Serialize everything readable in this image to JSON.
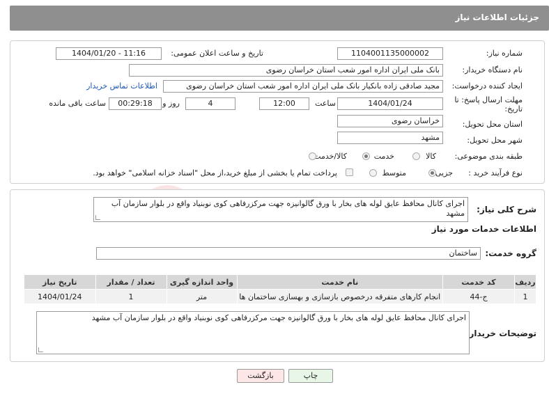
{
  "header": {
    "title": "جزئیات اطلاعات نیاز"
  },
  "form": {
    "need_number": {
      "label": "شماره نیاز:",
      "value": "1104001135000002"
    },
    "announce_datetime": {
      "label": "تاریخ و ساعت اعلان عمومی:",
      "value": "1404/01/20 - 11:16"
    },
    "buyer_org": {
      "label": "نام دستگاه خریدار:",
      "value": "بانک ملی ایران اداره امور شعب استان خراسان رضوی"
    },
    "requester": {
      "label": "ایجاد کننده درخواست:",
      "value": "مجید صادقی زاده بانکیار بانک ملی ایران اداره امور شعب استان خراسان رضوی",
      "contact_link": "اطلاعات تماس خریدار"
    },
    "deadline": {
      "label": "مهلت ارسال پاسخ: تا تاریخ:",
      "date": "1404/01/24",
      "time_label": "ساعت",
      "time": "12:00",
      "days": "4",
      "days_label": "روز و",
      "remaining": "00:29:18",
      "remaining_label": "ساعت باقی مانده"
    },
    "delivery_province": {
      "label": "استان محل تحویل:",
      "value": "خراسان رضوی"
    },
    "delivery_city": {
      "label": "شهر محل تحویل:",
      "value": "مشهد"
    },
    "category": {
      "label": "طبقه بندی موضوعی:",
      "options": [
        "کالا",
        "خدمت",
        "کالا/خدمت"
      ],
      "selected": "خدمت"
    },
    "process": {
      "label": "نوع فرآیند خرید :",
      "options": [
        "جزیی",
        "متوسط"
      ],
      "selected": "جزیی",
      "treasury_note": "پرداخت تمام یا بخشی از مبلغ خرید،از محل \"اسناد خزانه اسلامی\" خواهد بود."
    }
  },
  "summary": {
    "label": "شرح کلی نیاز:",
    "text": "اجرای کانال محافظ عایق لوله های بخار با ورق گالوانیزه جهت مرکزرفاهی کوی نوبنیاد واقع در بلوار سازمان آب مشهد"
  },
  "services": {
    "section_title": "اطلاعات خدمات مورد نیاز",
    "group_label": "گروه خدمت:",
    "group_value": "ساختمان",
    "table": {
      "headers": [
        "ردیف",
        "کد خدمت",
        "نام خدمت",
        "واحد اندازه گیری",
        "تعداد / مقدار",
        "تاریخ نیاز"
      ],
      "rows": [
        [
          "1",
          "ج-44",
          "انجام کارهای متفرقه درخصوص بازسازی و بهسازی ساختمان ها",
          "متر",
          "1",
          "1404/01/24"
        ]
      ]
    }
  },
  "buyer_notes": {
    "label": "توضیحات خریدار:",
    "text": "اجرای کانال محافظ عایق لوله های بخار با ورق گالوانیزه جهت مرکزرفاهی کوی نوبنیاد واقع در بلوار سازمان آب مشهد"
  },
  "buttons": {
    "print": "چاپ",
    "back": "بازگشت"
  },
  "watermark": {
    "text": "AriaTender.net"
  },
  "colors": {
    "header_bg": "#8f8f8f",
    "link": "#1b56b8",
    "back_btn_bg": "#fde6e6",
    "print_btn_bg": "#e8f6e8",
    "watermark": "#c00000"
  }
}
